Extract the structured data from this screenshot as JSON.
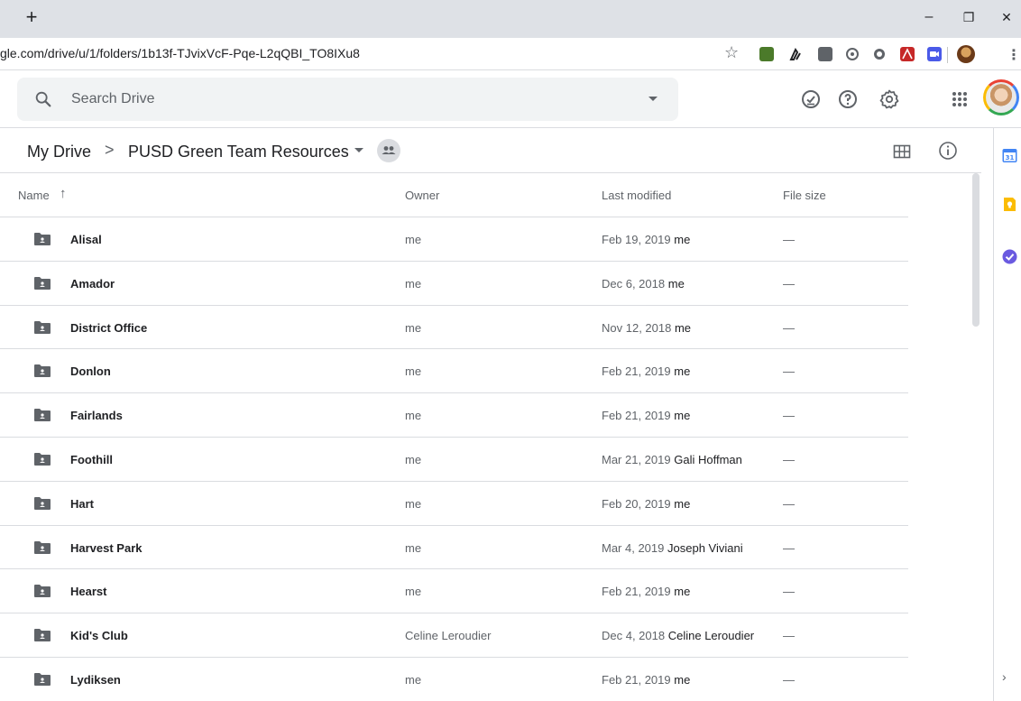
{
  "browser": {
    "new_tab_label": "+",
    "minimize_label": "–",
    "restore_label": "❐",
    "close_label": "✕",
    "url": "gle.com/drive/u/1/folders/1b13f-TJvixVcF-Pqe-L2qQBI_TO8IXu8",
    "bookmark_star": "☆",
    "menu_label": "⋮",
    "extension_colors": [
      "#4b7a2a",
      "#202124",
      "#5f6368",
      "#5f6368",
      "#5f6368",
      "#c62828",
      "#4a5ae8"
    ]
  },
  "header": {
    "search_placeholder": "Search Drive",
    "icons": [
      "search-icon",
      "ready-for-offline-icon",
      "help-icon",
      "settings-icon",
      "apps-grid-icon"
    ]
  },
  "breadcrumb": {
    "root": "My Drive",
    "separator": ">",
    "current": "PUSD Green Team Resources"
  },
  "columns": {
    "name": "Name",
    "sort_arrow": "↑",
    "owner": "Owner",
    "last_modified": "Last modified",
    "file_size": "File size"
  },
  "files": [
    {
      "name": "Alisal",
      "owner": "me",
      "date": "Feb 19, 2019",
      "by": "me",
      "size": "—"
    },
    {
      "name": "Amador",
      "owner": "me",
      "date": "Dec 6, 2018",
      "by": "me",
      "size": "—"
    },
    {
      "name": "District Office",
      "owner": "me",
      "date": "Nov 12, 2018",
      "by": "me",
      "size": "—"
    },
    {
      "name": "Donlon",
      "owner": "me",
      "date": "Feb 21, 2019",
      "by": "me",
      "size": "—"
    },
    {
      "name": "Fairlands",
      "owner": "me",
      "date": "Feb 21, 2019",
      "by": "me",
      "size": "—"
    },
    {
      "name": "Foothill",
      "owner": "me",
      "date": "Mar 21, 2019",
      "by": "Gali Hoffman",
      "size": "—"
    },
    {
      "name": "Hart",
      "owner": "me",
      "date": "Feb 20, 2019",
      "by": "me",
      "size": "—"
    },
    {
      "name": "Harvest Park",
      "owner": "me",
      "date": "Mar 4, 2019",
      "by": "Joseph Viviani",
      "size": "—"
    },
    {
      "name": "Hearst",
      "owner": "me",
      "date": "Feb 21, 2019",
      "by": "me",
      "size": "—"
    },
    {
      "name": "Kid's Club",
      "owner": "Celine Leroudier",
      "date": "Dec 4, 2018",
      "by": "Celine Leroudier",
      "size": "—"
    },
    {
      "name": "Lydiksen",
      "owner": "me",
      "date": "Feb 21, 2019",
      "by": "me",
      "size": "—"
    }
  ],
  "side_panel": {
    "calendar_day": "31",
    "chevron": "›",
    "calendar_color": "#4285f4",
    "keep_color": "#fbbc04",
    "tasks_color": "#6a5ae0"
  },
  "colors": {
    "folder": "#5f6368",
    "text": "#202124",
    "muted": "#5f6368",
    "divider": "#dadce0"
  }
}
